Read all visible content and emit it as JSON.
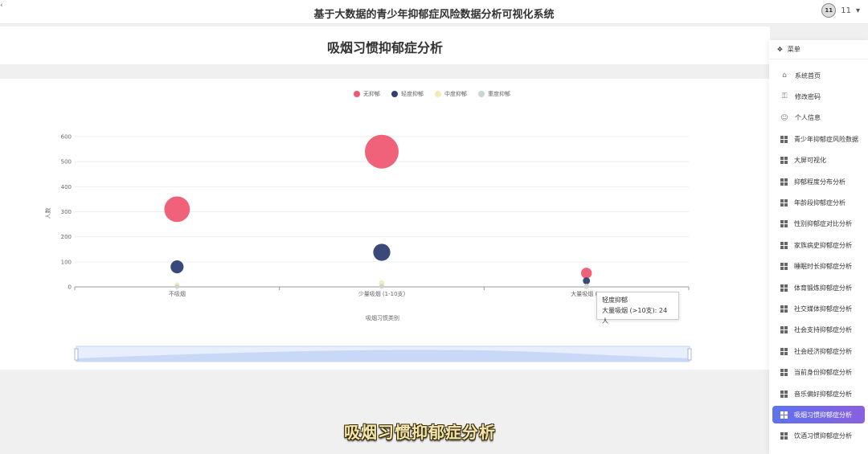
{
  "header": {
    "title": "基于大数据的青少年抑郁症风险数据分析可视化系统",
    "user_name": "11",
    "avatar_text": "11"
  },
  "page": {
    "title": "吸烟习惯抑郁症分析"
  },
  "menu": {
    "header_label": "菜单",
    "items": [
      {
        "label": "系统首页",
        "icon": "home-icon"
      },
      {
        "label": "修改密码",
        "icon": "lock-icon"
      },
      {
        "label": "个人信息",
        "icon": "user-icon"
      },
      {
        "label": "青少年抑郁症风险数据",
        "icon": "grid-icon"
      },
      {
        "label": "大屏可视化",
        "icon": "grid-icon"
      },
      {
        "label": "抑郁程度分布分析",
        "icon": "grid-icon"
      },
      {
        "label": "年龄段抑郁症分析",
        "icon": "grid-icon"
      },
      {
        "label": "性别抑郁症对比分析",
        "icon": "grid-icon"
      },
      {
        "label": "家族病史抑郁症分析",
        "icon": "grid-icon"
      },
      {
        "label": "睡眠时长抑郁症分析",
        "icon": "grid-icon"
      },
      {
        "label": "体育锻炼抑郁症分析",
        "icon": "grid-icon"
      },
      {
        "label": "社交媒体抑郁症分析",
        "icon": "grid-icon"
      },
      {
        "label": "社会支持抑郁症分析",
        "icon": "grid-icon"
      },
      {
        "label": "社会经济抑郁症分析",
        "icon": "grid-icon"
      },
      {
        "label": "当前身份抑郁症分析",
        "icon": "grid-icon"
      },
      {
        "label": "音乐偏好抑郁症分析",
        "icon": "grid-icon"
      },
      {
        "label": "吸烟习惯抑郁症分析",
        "icon": "grid-icon",
        "active": true
      },
      {
        "label": "饮酒习惯抑郁症分析",
        "icon": "grid-icon"
      }
    ]
  },
  "chart_data": {
    "type": "scatter",
    "title": "",
    "xlabel": "吸烟习惯类别",
    "ylabel": "人数",
    "categories": [
      "不吸烟",
      "少量吸烟 (1-10支)",
      "大量吸烟 (>10支)"
    ],
    "category_tick_labels": [
      "不吸烟",
      "少量吸烟 (1-10支)",
      "大量吸烟 (>"
    ],
    "ylim": [
      0,
      600
    ],
    "yticks": [
      0,
      100,
      200,
      300,
      400,
      500,
      600
    ],
    "grid": true,
    "legend_position": "top-center",
    "series": [
      {
        "name": "无抑郁",
        "color": "#ee5a73",
        "values": [
          310,
          540,
          55
        ]
      },
      {
        "name": "轻度抑郁",
        "color": "#2e3f73",
        "values": [
          80,
          138,
          24
        ]
      },
      {
        "name": "中度抑郁",
        "color": "#f6e9b8",
        "values": [
          8,
          15,
          3
        ]
      },
      {
        "name": "重度抑郁",
        "color": "#c9d6d4",
        "values": [
          1,
          2,
          1
        ]
      }
    ],
    "tooltip": {
      "series": "轻度抑郁",
      "text": "大量吸烟 (>10支): 24人"
    }
  },
  "caption": "吸烟习惯抑郁症分析"
}
